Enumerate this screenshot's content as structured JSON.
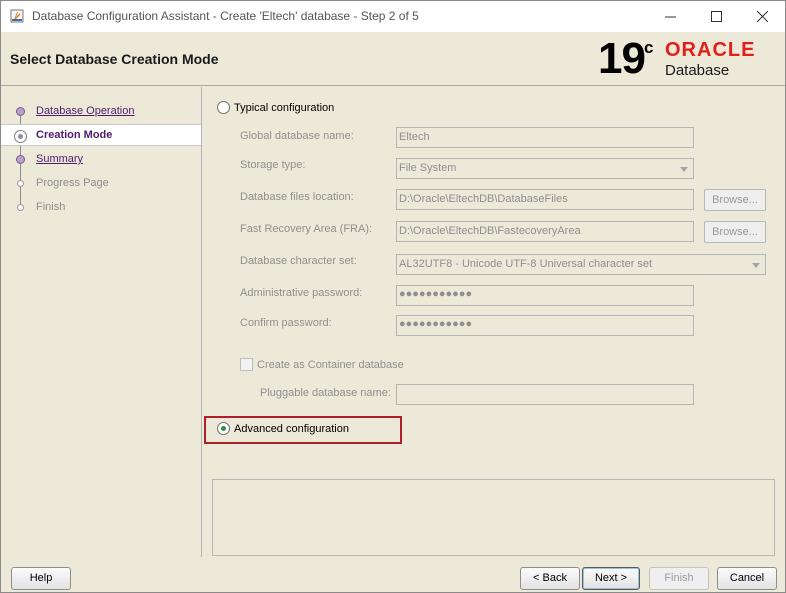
{
  "window": {
    "title": "Database Configuration Assistant - Create 'Eltech' database - Step 2 of 5",
    "minimize_icon": "minimize-icon",
    "maximize_icon": "maximize-icon",
    "close_icon": "close-icon"
  },
  "header": {
    "page_title": "Select Database Creation Mode",
    "logo_version": "19",
    "logo_superscript": "c",
    "logo_brand": "ORACLE",
    "logo_product": "Database",
    "logo_brand_color": "#e0201b"
  },
  "steps": [
    {
      "label": "Database Operation",
      "state": "link"
    },
    {
      "label": "Creation Mode",
      "state": "current"
    },
    {
      "label": "Summary",
      "state": "link"
    },
    {
      "label": "Progress Page",
      "state": "disabled"
    },
    {
      "label": "Finish",
      "state": "disabled"
    }
  ],
  "form": {
    "typical_label": "Typical configuration",
    "typical_selected": false,
    "global_db_name_label": "Global database name:",
    "global_db_name_value": "Eltech",
    "storage_type_label": "Storage type:",
    "storage_type_value": "File System",
    "db_files_location_label": "Database files location:",
    "db_files_location_value": "D:\\Oracle\\EltechDB\\DatabaseFiles",
    "fra_label": "Fast Recovery Area (FRA):",
    "fra_value": "D:\\Oracle\\EltechDB\\FastecoveryArea",
    "browse_label": "Browse...",
    "charset_label": "Database character set:",
    "charset_value": "AL32UTF8 - Unicode UTF-8 Universal character set",
    "admin_password_label": "Administrative password:",
    "admin_password_value": "●●●●●●●●●●●",
    "confirm_password_label": "Confirm password:",
    "confirm_password_value": "●●●●●●●●●●●",
    "container_db_label": "Create as Container database",
    "container_db_checked": false,
    "pdb_name_label": "Pluggable database name:",
    "pdb_name_value": "",
    "advanced_label": "Advanced configuration",
    "advanced_selected": true,
    "highlight_color": "#b01e2a"
  },
  "footer": {
    "help": "Help",
    "back": "< Back",
    "next": "Next >",
    "finish": "Finish",
    "cancel": "Cancel"
  }
}
